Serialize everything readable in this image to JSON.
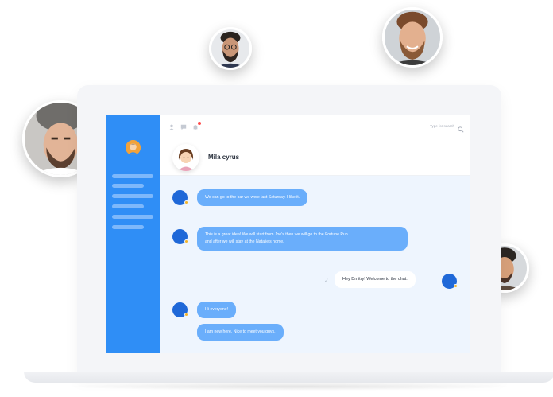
{
  "app": {
    "search_placeholder": "Type for search",
    "contact": {
      "name": "Mila cyrus"
    },
    "messages": [
      {
        "direction": "in",
        "text": "We can go to the bar we were last Saturday. I like it."
      },
      {
        "direction": "in",
        "text": "This is a great idea! We will start from Joe's then we will go to the Fortune Pub",
        "text2": "and after we will stay at the Natalie's home."
      },
      {
        "direction": "out",
        "text": "Hey Dmitry! Welcome to the chat."
      },
      {
        "direction": "in",
        "text": "Hi everyone!"
      },
      {
        "direction": "in",
        "text": "I am new here. Nice to meet you guys."
      }
    ]
  },
  "colors": {
    "sidebar": "#2f8ef6",
    "bubble_incoming": "#6aaefb",
    "chat_background": "#eef5fe",
    "avatar_blue": "#1f68d8",
    "notification": "#ff4b4b"
  },
  "icons": {
    "topbar": [
      "people-icon",
      "chat-icon",
      "bell-icon"
    ],
    "search": "search-icon",
    "read_receipt": "check-icon"
  }
}
